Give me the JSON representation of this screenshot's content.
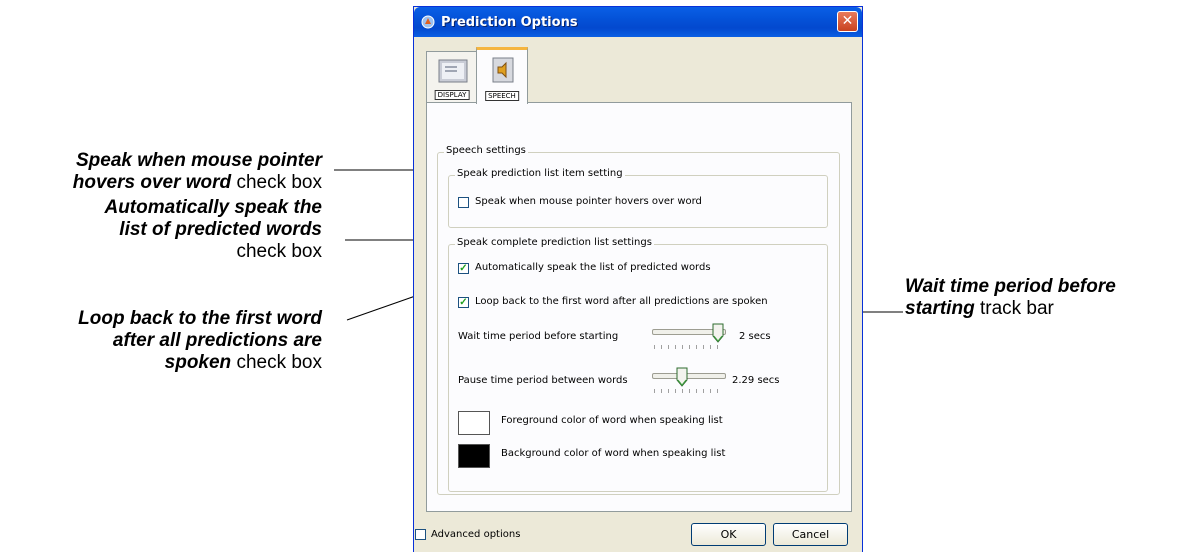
{
  "dialog": {
    "title": "Prediction Options",
    "tabs": [
      {
        "label": "DISPLAY",
        "icon": "monitor-icon"
      },
      {
        "label": "SPEECH",
        "icon": "speaker-icon"
      }
    ],
    "speech_settings": {
      "title": "Speech settings",
      "item_group": {
        "title": "Speak prediction list item setting",
        "hover_checkbox": {
          "label": "Speak when mouse pointer hovers over word",
          "checked": false
        }
      },
      "list_group": {
        "title": "Speak complete prediction list settings",
        "auto_speak_checkbox": {
          "label": "Automatically speak the list of predicted words",
          "checked": true
        },
        "loop_back_checkbox": {
          "label": "Loop back to the first word after all predictions are spoken",
          "checked": true
        },
        "wait_time": {
          "label": "Wait time period before starting",
          "value_text": "2 secs",
          "level": 1.0
        },
        "pause_time": {
          "label": "Pause time period between words",
          "value_text": "2.29 secs",
          "level": 0.4
        },
        "foreground": {
          "label": "Foreground color of word when speaking list",
          "color": "#ffffff"
        },
        "background": {
          "label": "Background color of word when speaking list",
          "color": "#000000"
        }
      }
    },
    "advanced_checkbox": {
      "label": "Advanced options",
      "checked": false
    },
    "ok_label": "OK",
    "cancel_label": "Cancel"
  },
  "callouts": {
    "hover": {
      "bold": "Speak when mouse pointer hovers over word",
      "plain": "check box"
    },
    "auto": {
      "bold1": "Automatically speak the",
      "bold2": "list of predicted words",
      "plain": "check box"
    },
    "loop": {
      "bold1": "Loop back to the first word",
      "bold2": "after all predictions are",
      "bold3": "spoken",
      "plain": "check box"
    },
    "wait": {
      "bold1": "Wait time period before",
      "bold2": "starting",
      "plain": "track bar"
    }
  },
  "colors": {
    "check_mark": "#21a121",
    "title_bar": "#0452d8",
    "accent_tab": "#f5b53f"
  }
}
